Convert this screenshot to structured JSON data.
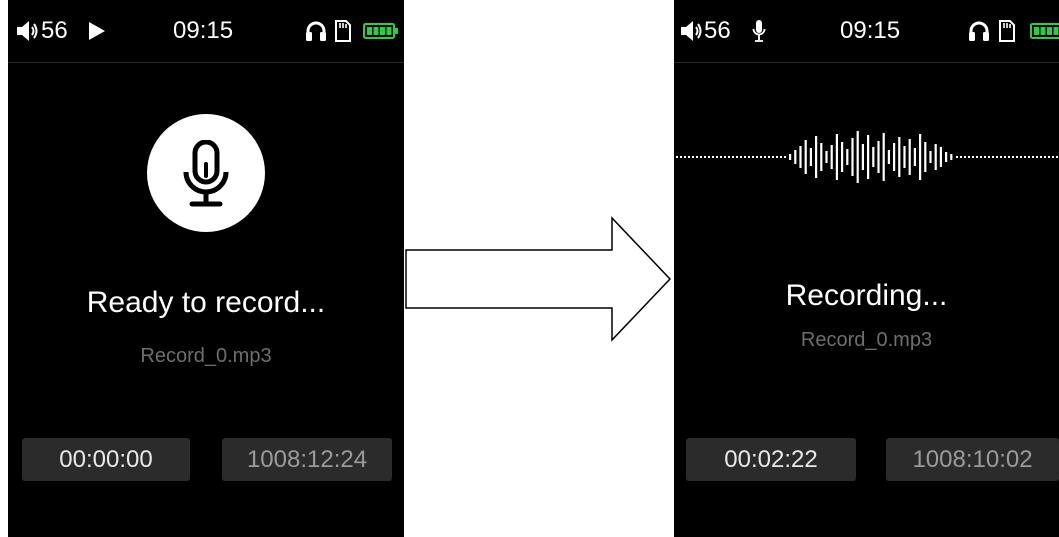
{
  "left_screen": {
    "status_bar": {
      "volume_value": "56",
      "time": "09:15"
    },
    "title": "Ready to record...",
    "filename": "Record_0.mp3",
    "elapsed": "00:00:00",
    "remaining": "1008:12:24"
  },
  "right_screen": {
    "status_bar": {
      "volume_value": "56",
      "time": "09:15"
    },
    "title": "Recording...",
    "filename": "Record_0.mp3",
    "elapsed": "00:02:22",
    "remaining": "1008:10:02"
  },
  "colors": {
    "screen_bg": "#000000",
    "battery_green": "#2ecc40",
    "time_box_bg": "#2b2b2b",
    "filename_gray": "#6e6e6e"
  },
  "icons": [
    "speaker-icon",
    "play-icon",
    "microphone-icon",
    "headphones-icon",
    "sd-card-icon",
    "battery-icon",
    "arrow-right-icon",
    "waveform-icon"
  ]
}
